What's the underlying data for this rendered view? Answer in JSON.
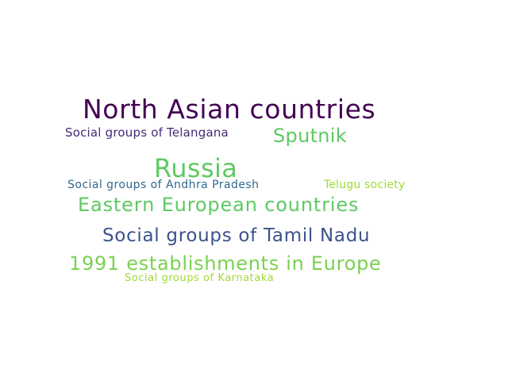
{
  "word_cloud": {
    "words": [
      {
        "id": "north-asian",
        "text": "North Asian countries",
        "color": "#440154"
      },
      {
        "id": "telangana",
        "text": "Social groups of Telangana",
        "color": "#482878"
      },
      {
        "id": "sputnik",
        "text": "Sputnik",
        "color": "#5ec962"
      },
      {
        "id": "russia",
        "text": "Russia",
        "color": "#5ec962"
      },
      {
        "id": "andhra",
        "text": "Social groups of Andhra Pradesh",
        "color": "#31688e"
      },
      {
        "id": "telugu",
        "text": "Telugu society",
        "color": "#a0da39"
      },
      {
        "id": "eastern-european",
        "text": "Eastern European countries",
        "color": "#5ec962"
      },
      {
        "id": "tamil-nadu",
        "text": "Social groups of Tamil Nadu",
        "color": "#3b528b"
      },
      {
        "id": "establishments-1991",
        "text": "1991 establishments in Europe",
        "color": "#7ad151"
      },
      {
        "id": "karnataka",
        "text": "Social groups of Karnataka",
        "color": "#a0da39"
      }
    ]
  }
}
